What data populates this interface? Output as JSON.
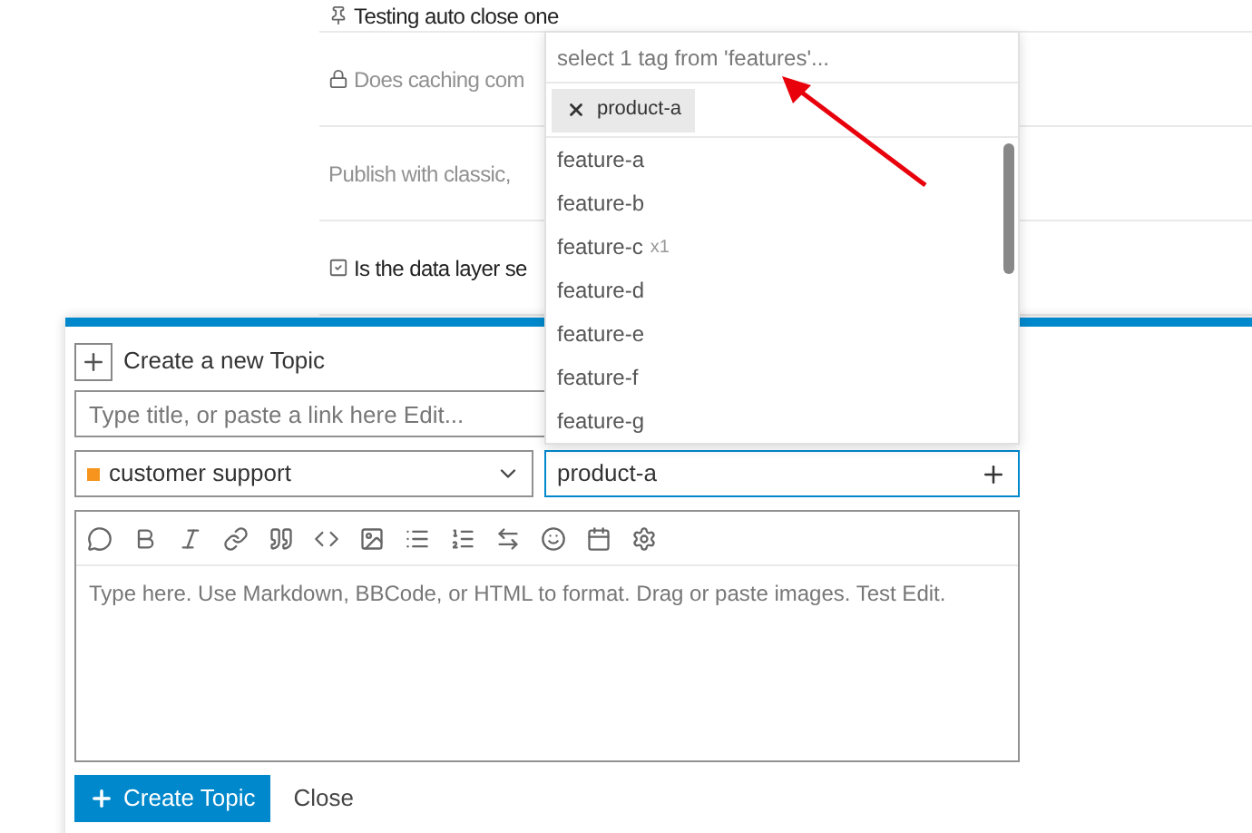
{
  "topic_list": [
    {
      "kind": "pinned",
      "title": "Testing auto close one",
      "muted": false
    },
    {
      "kind": "locked",
      "title": "Does caching com",
      "muted": true
    },
    {
      "kind": "plain",
      "title": "Publish with classic, ",
      "muted": true
    },
    {
      "kind": "solved",
      "title": "Is the data layer se",
      "muted": false
    }
  ],
  "composer": {
    "heading": "Create a new Topic",
    "title_placeholder": "Type title, or paste a link here Edit...",
    "category": {
      "name": "customer support",
      "color": "#f7941d"
    },
    "tags_value": "product-a",
    "editor_placeholder": "Type here. Use Markdown, BBCode, or HTML to format. Drag or paste images. Test Edit.",
    "primary_button": "Create Topic",
    "secondary_button": "Close"
  },
  "tag_dropdown": {
    "filter_placeholder": "select 1 tag from 'features'...",
    "chips": [
      "product-a"
    ],
    "options": [
      {
        "name": "feature-a"
      },
      {
        "name": "feature-b"
      },
      {
        "name": "feature-c",
        "count": "x1"
      },
      {
        "name": "feature-d"
      },
      {
        "name": "feature-e"
      },
      {
        "name": "feature-f"
      },
      {
        "name": "feature-g"
      }
    ]
  }
}
